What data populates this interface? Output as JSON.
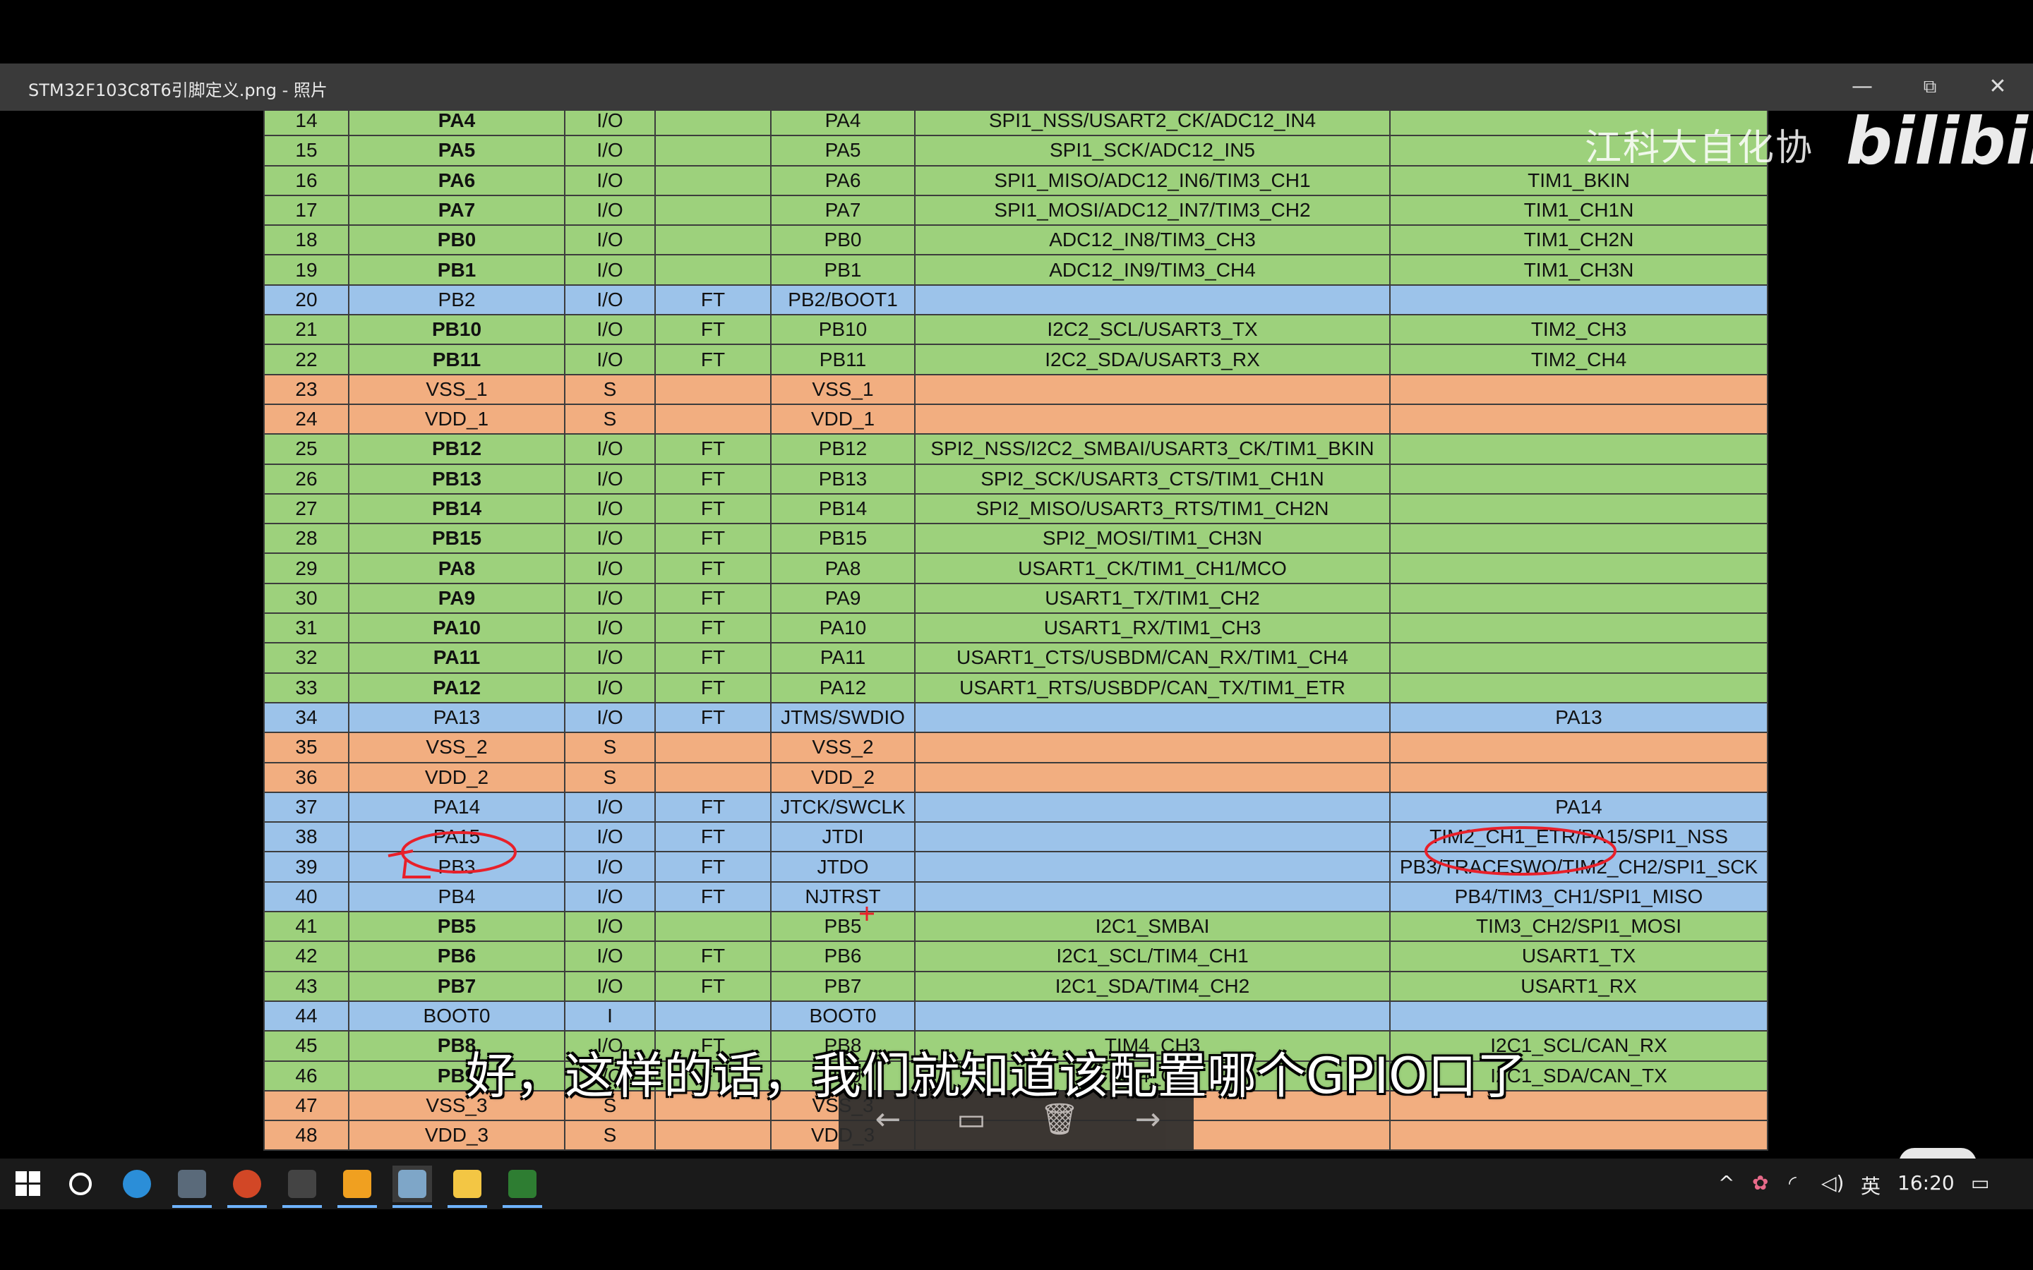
{
  "window": {
    "title": "STM32F103C8T6引脚定义.png - 照片",
    "minimize_icon": "—",
    "restore_icon": "⧉",
    "close_icon": "✕"
  },
  "table": {
    "rows": [
      {
        "num": "14",
        "pin": "PA4",
        "type": "I/O",
        "level": "",
        "main": "PA4",
        "default": "SPI1_NSS/USART2_CK/ADC12_IN4",
        "remap": "",
        "color": "green",
        "bold": true
      },
      {
        "num": "15",
        "pin": "PA5",
        "type": "I/O",
        "level": "",
        "main": "PA5",
        "default": "SPI1_SCK/ADC12_IN5",
        "remap": "",
        "color": "green",
        "bold": true
      },
      {
        "num": "16",
        "pin": "PA6",
        "type": "I/O",
        "level": "",
        "main": "PA6",
        "default": "SPI1_MISO/ADC12_IN6/TIM3_CH1",
        "remap": "TIM1_BKIN",
        "color": "green",
        "bold": true
      },
      {
        "num": "17",
        "pin": "PA7",
        "type": "I/O",
        "level": "",
        "main": "PA7",
        "default": "SPI1_MOSI/ADC12_IN7/TIM3_CH2",
        "remap": "TIM1_CH1N",
        "color": "green",
        "bold": true
      },
      {
        "num": "18",
        "pin": "PB0",
        "type": "I/O",
        "level": "",
        "main": "PB0",
        "default": "ADC12_IN8/TIM3_CH3",
        "remap": "TIM1_CH2N",
        "color": "green",
        "bold": true
      },
      {
        "num": "19",
        "pin": "PB1",
        "type": "I/O",
        "level": "",
        "main": "PB1",
        "default": "ADC12_IN9/TIM3_CH4",
        "remap": "TIM1_CH3N",
        "color": "green",
        "bold": true
      },
      {
        "num": "20",
        "pin": "PB2",
        "type": "I/O",
        "level": "FT",
        "main": "PB2/BOOT1",
        "default": "",
        "remap": "",
        "color": "blue",
        "bold": false
      },
      {
        "num": "21",
        "pin": "PB10",
        "type": "I/O",
        "level": "FT",
        "main": "PB10",
        "default": "I2C2_SCL/USART3_TX",
        "remap": "TIM2_CH3",
        "color": "green",
        "bold": true
      },
      {
        "num": "22",
        "pin": "PB11",
        "type": "I/O",
        "level": "FT",
        "main": "PB11",
        "default": "I2C2_SDA/USART3_RX",
        "remap": "TIM2_CH4",
        "color": "green",
        "bold": true
      },
      {
        "num": "23",
        "pin": "VSS_1",
        "type": "S",
        "level": "",
        "main": "VSS_1",
        "default": "",
        "remap": "",
        "color": "orange",
        "bold": false
      },
      {
        "num": "24",
        "pin": "VDD_1",
        "type": "S",
        "level": "",
        "main": "VDD_1",
        "default": "",
        "remap": "",
        "color": "orange",
        "bold": false
      },
      {
        "num": "25",
        "pin": "PB12",
        "type": "I/O",
        "level": "FT",
        "main": "PB12",
        "default": "SPI2_NSS/I2C2_SMBAI/USART3_CK/TIM1_BKIN",
        "remap": "",
        "color": "green",
        "bold": true
      },
      {
        "num": "26",
        "pin": "PB13",
        "type": "I/O",
        "level": "FT",
        "main": "PB13",
        "default": "SPI2_SCK/USART3_CTS/TIM1_CH1N",
        "remap": "",
        "color": "green",
        "bold": true
      },
      {
        "num": "27",
        "pin": "PB14",
        "type": "I/O",
        "level": "FT",
        "main": "PB14",
        "default": "SPI2_MISO/USART3_RTS/TIM1_CH2N",
        "remap": "",
        "color": "green",
        "bold": true
      },
      {
        "num": "28",
        "pin": "PB15",
        "type": "I/O",
        "level": "FT",
        "main": "PB15",
        "default": "SPI2_MOSI/TIM1_CH3N",
        "remap": "",
        "color": "green",
        "bold": true
      },
      {
        "num": "29",
        "pin": "PA8",
        "type": "I/O",
        "level": "FT",
        "main": "PA8",
        "default": "USART1_CK/TIM1_CH1/MCO",
        "remap": "",
        "color": "green",
        "bold": true
      },
      {
        "num": "30",
        "pin": "PA9",
        "type": "I/O",
        "level": "FT",
        "main": "PA9",
        "default": "USART1_TX/TIM1_CH2",
        "remap": "",
        "color": "green",
        "bold": true
      },
      {
        "num": "31",
        "pin": "PA10",
        "type": "I/O",
        "level": "FT",
        "main": "PA10",
        "default": "USART1_RX/TIM1_CH3",
        "remap": "",
        "color": "green",
        "bold": true
      },
      {
        "num": "32",
        "pin": "PA11",
        "type": "I/O",
        "level": "FT",
        "main": "PA11",
        "default": "USART1_CTS/USBDM/CAN_RX/TIM1_CH4",
        "remap": "",
        "color": "green",
        "bold": true
      },
      {
        "num": "33",
        "pin": "PA12",
        "type": "I/O",
        "level": "FT",
        "main": "PA12",
        "default": "USART1_RTS/USBDP/CAN_TX/TIM1_ETR",
        "remap": "",
        "color": "green",
        "bold": true
      },
      {
        "num": "34",
        "pin": "PA13",
        "type": "I/O",
        "level": "FT",
        "main": "JTMS/SWDIO",
        "default": "",
        "remap": "PA13",
        "color": "blue",
        "bold": false
      },
      {
        "num": "35",
        "pin": "VSS_2",
        "type": "S",
        "level": "",
        "main": "VSS_2",
        "default": "",
        "remap": "",
        "color": "orange",
        "bold": false
      },
      {
        "num": "36",
        "pin": "VDD_2",
        "type": "S",
        "level": "",
        "main": "VDD_2",
        "default": "",
        "remap": "",
        "color": "orange",
        "bold": false
      },
      {
        "num": "37",
        "pin": "PA14",
        "type": "I/O",
        "level": "FT",
        "main": "JTCK/SWCLK",
        "default": "",
        "remap": "PA14",
        "color": "blue",
        "bold": false
      },
      {
        "num": "38",
        "pin": "PA15",
        "type": "I/O",
        "level": "FT",
        "main": "JTDI",
        "default": "",
        "remap": "TIM2_CH1_ETR/PA15/SPI1_NSS",
        "color": "blue",
        "bold": false
      },
      {
        "num": "39",
        "pin": "PB3",
        "type": "I/O",
        "level": "FT",
        "main": "JTDO",
        "default": "",
        "remap": "PB3/TRACESWO/TIM2_CH2/SPI1_SCK",
        "color": "blue",
        "bold": false
      },
      {
        "num": "40",
        "pin": "PB4",
        "type": "I/O",
        "level": "FT",
        "main": "NJTRST",
        "default": "",
        "remap": "PB4/TIM3_CH1/SPI1_MISO",
        "color": "blue",
        "bold": false
      },
      {
        "num": "41",
        "pin": "PB5",
        "type": "I/O",
        "level": "",
        "main": "PB5",
        "default": "I2C1_SMBAI",
        "remap": "TIM3_CH2/SPI1_MOSI",
        "color": "green",
        "bold": true
      },
      {
        "num": "42",
        "pin": "PB6",
        "type": "I/O",
        "level": "FT",
        "main": "PB6",
        "default": "I2C1_SCL/TIM4_CH1",
        "remap": "USART1_TX",
        "color": "green",
        "bold": true
      },
      {
        "num": "43",
        "pin": "PB7",
        "type": "I/O",
        "level": "FT",
        "main": "PB7",
        "default": "I2C1_SDA/TIM4_CH2",
        "remap": "USART1_RX",
        "color": "green",
        "bold": true
      },
      {
        "num": "44",
        "pin": "BOOT0",
        "type": "I",
        "level": "",
        "main": "BOOT0",
        "default": "",
        "remap": "",
        "color": "blue",
        "bold": false
      },
      {
        "num": "45",
        "pin": "PB8",
        "type": "I/O",
        "level": "FT",
        "main": "PB8",
        "default": "TIM4_CH3",
        "remap": "I2C1_SCL/CAN_RX",
        "color": "green",
        "bold": true
      },
      {
        "num": "46",
        "pin": "PB9",
        "type": "I/O",
        "level": "FT",
        "main": "PB9",
        "default": "TIM4_CH4",
        "remap": "I2C1_SDA/CAN_TX",
        "color": "green",
        "bold": true
      },
      {
        "num": "47",
        "pin": "VSS_3",
        "type": "S",
        "level": "",
        "main": "VSS_3",
        "default": "",
        "remap": "",
        "color": "orange",
        "bold": false
      },
      {
        "num": "48",
        "pin": "VDD_3",
        "type": "S",
        "level": "",
        "main": "VDD_3",
        "default": "",
        "remap": "",
        "color": "orange",
        "bold": false
      }
    ]
  },
  "overlay": {
    "watermark_text": "江科大自化协",
    "brand_logo_text": "bilibili",
    "subtitle": "好，这样的话，我们就知道该配置哪个GPIO口了",
    "annotation_color": "#e8202a"
  },
  "viewer_controls": {
    "prev_icon": "←",
    "slideshow_icon": "▭",
    "delete_icon": "🗑",
    "next_icon": "→"
  },
  "taskbar": {
    "input_method": "英",
    "clock": "16:20"
  },
  "colors": {
    "row_green": "#9dd17c",
    "row_blue": "#9cc3ea",
    "row_orange": "#f2ae80",
    "taskbar_bg": "#1a1a1a",
    "titlebar_bg": "#3a3a3a"
  }
}
